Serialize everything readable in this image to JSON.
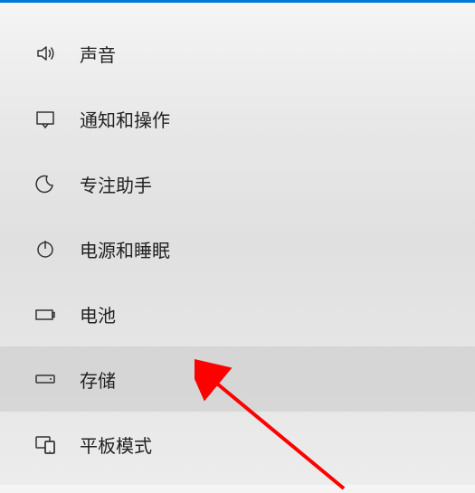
{
  "sidebar": {
    "items": [
      {
        "label": "声音",
        "icon": "sound-icon",
        "selected": false
      },
      {
        "label": "通知和操作",
        "icon": "notifications-icon",
        "selected": false
      },
      {
        "label": "专注助手",
        "icon": "focus-assist-icon",
        "selected": false
      },
      {
        "label": "电源和睡眠",
        "icon": "power-sleep-icon",
        "selected": false
      },
      {
        "label": "电池",
        "icon": "battery-icon",
        "selected": false
      },
      {
        "label": "存储",
        "icon": "storage-icon",
        "selected": true
      },
      {
        "label": "平板模式",
        "icon": "tablet-mode-icon",
        "selected": false
      }
    ]
  },
  "annotation": {
    "type": "arrow",
    "color": "#ff0000",
    "target": "存储"
  }
}
